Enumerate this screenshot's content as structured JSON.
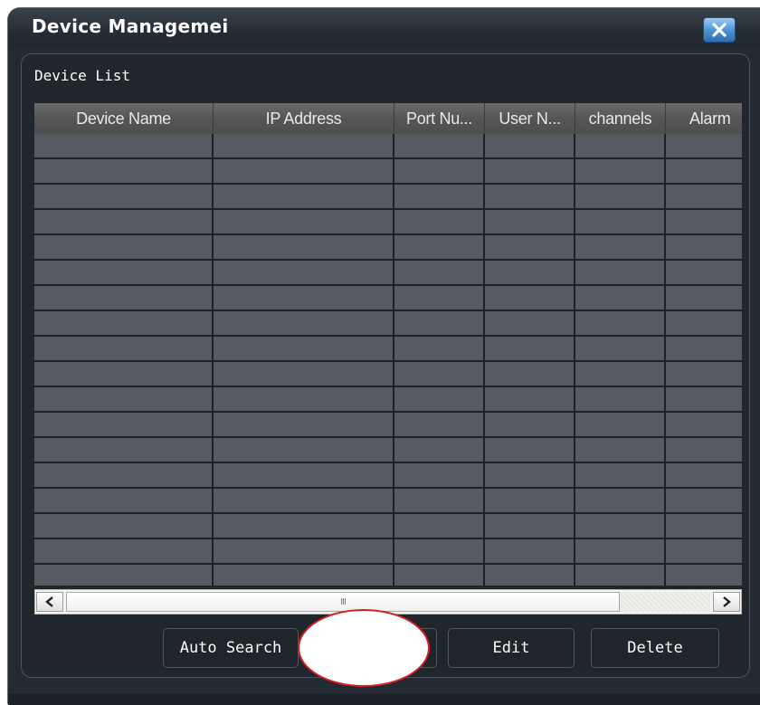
{
  "window": {
    "title": "Device Managemei",
    "close_icon": "close-x-icon"
  },
  "section": {
    "label": "Device List"
  },
  "table": {
    "columns": [
      {
        "label": "Device Name"
      },
      {
        "label": "IP Address"
      },
      {
        "label": "Port Nu..."
      },
      {
        "label": "User N..."
      },
      {
        "label": "channels"
      },
      {
        "label": "Alarm"
      }
    ],
    "empty_row_count": 20
  },
  "scrollbar": {
    "left_arrow_icon": "chevron-left-icon",
    "right_arrow_icon": "chevron-right-icon",
    "thumb_grip": "III"
  },
  "buttons": {
    "auto_search": "Auto Search",
    "edit": "Edit",
    "delete": "Delete"
  },
  "colors": {
    "background": "#232a31",
    "grid_cell": "#56595f",
    "close_button": "#4a90cf",
    "redaction_outline": "#d42020"
  }
}
